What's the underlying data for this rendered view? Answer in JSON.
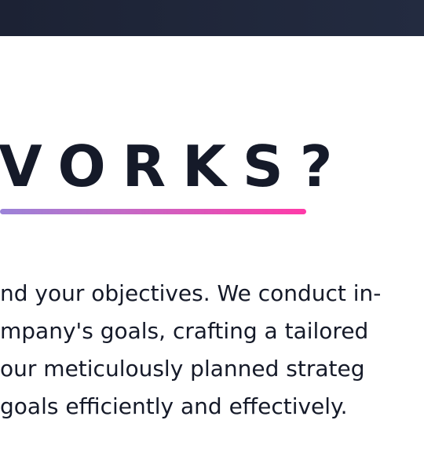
{
  "section": {
    "heading": "VORKS?",
    "paragraph_lines": [
      "nd your objectives. We conduct in-",
      "mpany's goals, crafting a tailored",
      " our meticulously planned strateg",
      "goals efficiently and effectively."
    ]
  },
  "colors": {
    "top_bar": "#1c2234",
    "heading_text": "#151a29",
    "underline_start": "#9b83d8",
    "underline_end": "#ff3aa8"
  }
}
